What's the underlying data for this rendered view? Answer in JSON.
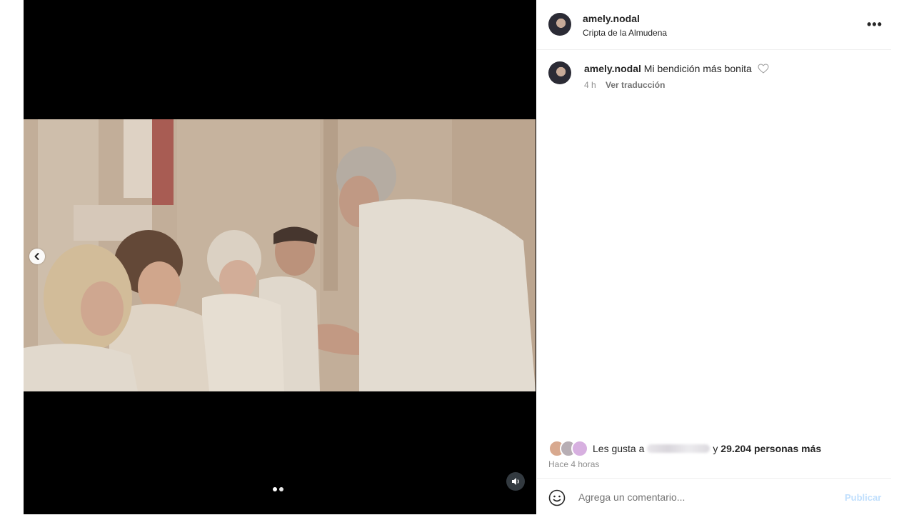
{
  "post": {
    "username": "amely.nodal",
    "location": "Cripta de la Almudena",
    "caption_text": "Mi bendición más bonita",
    "caption_time": "4 h",
    "translate_label": "Ver traducción",
    "likes_prefix": "Les gusta a",
    "likes_suffix_connector": "y",
    "likes_count": "29.204 personas más",
    "posted_ago": "Hace 4 horas"
  },
  "media": {
    "carousel_dots": 2,
    "prev_icon": "chevron-left-icon",
    "mute_icon": "speaker-icon"
  },
  "comment": {
    "placeholder": "Agrega un comentario...",
    "publish_label": "Publicar"
  },
  "colors": {
    "accent_disabled": "#c0dffd",
    "muted_text": "#8e8e8e",
    "media_bg": "#000000"
  }
}
